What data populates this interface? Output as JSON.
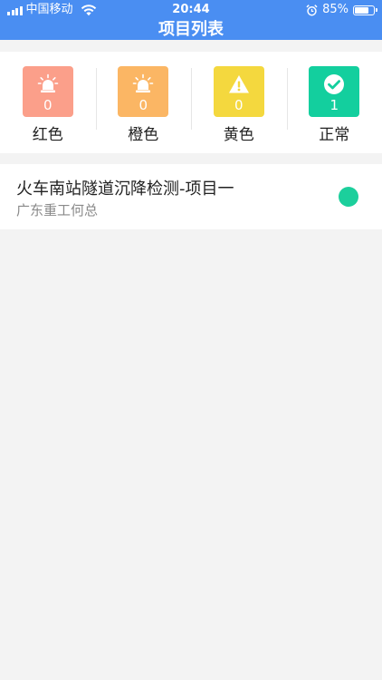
{
  "status_bar": {
    "carrier": "中国移动",
    "time": "20:44",
    "battery_text": "85%",
    "battery_level": 0.85
  },
  "nav": {
    "title": "项目列表"
  },
  "summary": {
    "items": [
      {
        "key": "red",
        "label": "红色",
        "count": "0",
        "color": "#fb9f8a",
        "icon": "alarm-light-icon"
      },
      {
        "key": "orange",
        "label": "橙色",
        "count": "0",
        "color": "#fbb664",
        "icon": "alarm-light-icon"
      },
      {
        "key": "yellow",
        "label": "黄色",
        "count": "0",
        "color": "#f4d83e",
        "icon": "warning-icon"
      },
      {
        "key": "normal",
        "label": "正常",
        "count": "1",
        "color": "#13cf9e",
        "icon": "check-circle-icon"
      }
    ]
  },
  "projects": [
    {
      "title": "火车南站隧道沉降检测-项目一",
      "subtitle": "广东重工何总",
      "status_color": "#1ccf9c"
    }
  ],
  "colors": {
    "header": "#4a8ef2",
    "background": "#f3f3f3"
  }
}
